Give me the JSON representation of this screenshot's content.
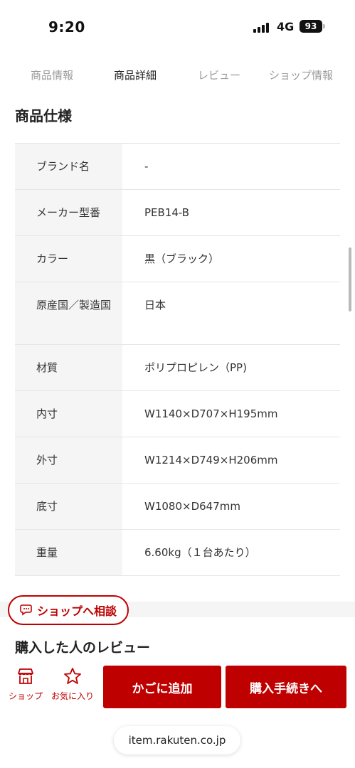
{
  "status_bar": {
    "time": "9:20",
    "network": "4G",
    "battery": "93"
  },
  "tabs": [
    {
      "label": "商品情報",
      "active": false
    },
    {
      "label": "商品詳細",
      "active": true
    },
    {
      "label": "レビュー",
      "active": false
    },
    {
      "label": "ショップ情報",
      "active": false
    }
  ],
  "section_title": "商品仕様",
  "specs": [
    {
      "label": "ブランド名",
      "value": "-"
    },
    {
      "label": "メーカー型番",
      "value": "PEB14-B"
    },
    {
      "label": "カラー",
      "value": "黒（ブラック）"
    },
    {
      "label": "原産国／製造国",
      "value": "日本"
    },
    {
      "label": "材質",
      "value": "ポリプロピレン（PP)"
    },
    {
      "label": "内寸",
      "value": "W1140×D707×H195mm"
    },
    {
      "label": "外寸",
      "value": "W1214×D749×H206mm"
    },
    {
      "label": "底寸",
      "value": "W1080×D647mm"
    },
    {
      "label": "重量",
      "value": "6.60kg（１台あたり）"
    }
  ],
  "consult_button": "ショップへ相談",
  "reviews_title": "購入した人のレビュー",
  "action_bar": {
    "shop_label": "ショップ",
    "favorite_label": "お気に入り",
    "add_to_cart": "かごに追加",
    "checkout": "購入手続きへ"
  },
  "url": "item.rakuten.co.jp",
  "colors": {
    "accent": "#bf0000",
    "label_bg": "#f5f5f5"
  }
}
